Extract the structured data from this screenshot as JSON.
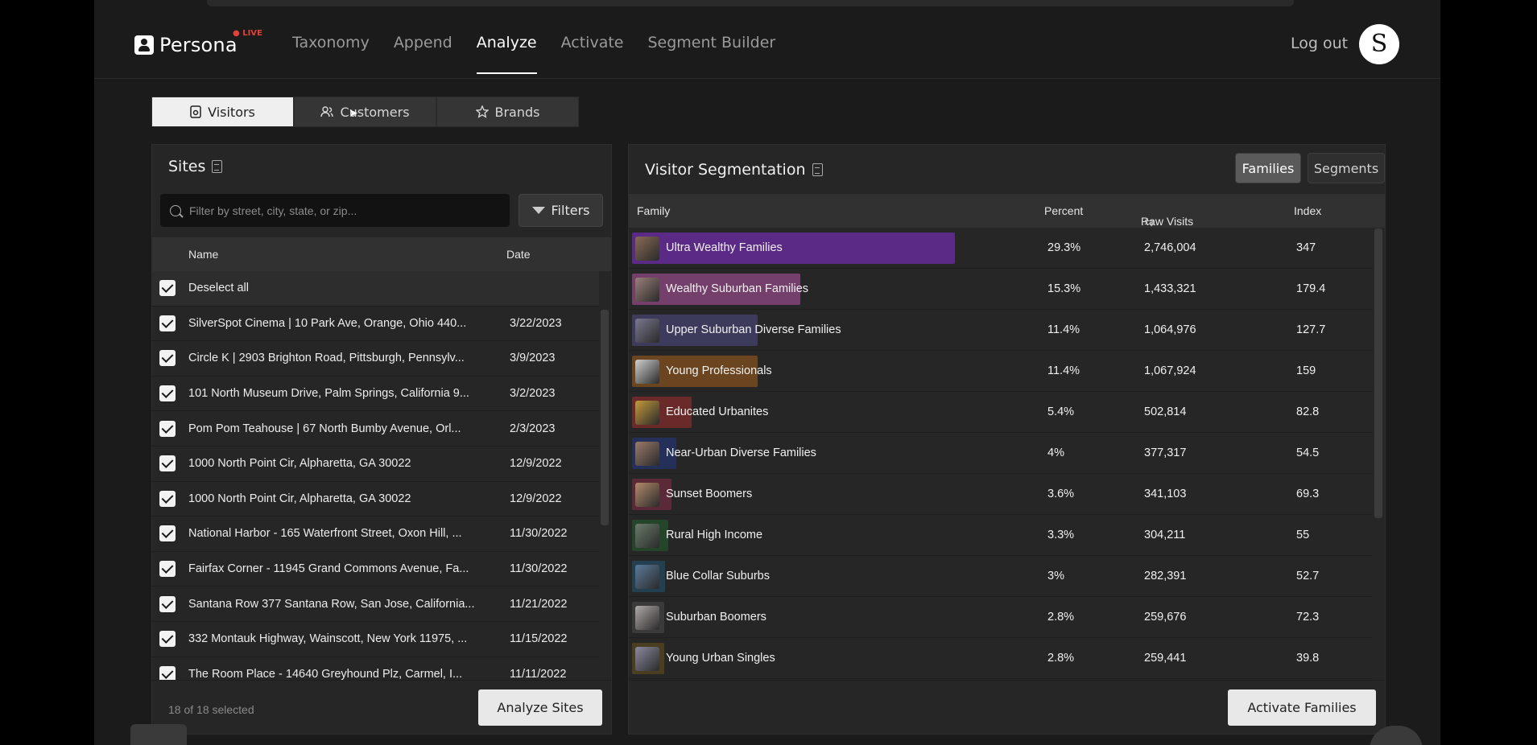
{
  "nav": {
    "brand": "Persona",
    "brand_badge": "● LIVE",
    "links": [
      "Taxonomy",
      "Append",
      "Analyze",
      "Activate",
      "Segment Builder"
    ],
    "active": "Analyze",
    "logout": "Log out",
    "avatar_letter": "S"
  },
  "tabs": [
    {
      "label": "Visitors",
      "icon": "visitors-icon",
      "active": true
    },
    {
      "label": "Customers",
      "icon": "customers-icon",
      "active": false
    },
    {
      "label": "Brands",
      "icon": "star-icon",
      "active": false
    }
  ],
  "sites": {
    "title": "Sites",
    "search_placeholder": "Filter by street, city, state, or zip...",
    "filters_label": "Filters",
    "col_name": "Name",
    "col_date": "Date",
    "deselect_all": "Deselect all",
    "rows": [
      {
        "name": "SilverSpot Cinema | 10 Park Ave, Orange, Ohio 440...",
        "date": "3/22/2023"
      },
      {
        "name": "Circle K | 2903 Brighton Road, Pittsburgh, Pennsylv...",
        "date": "3/9/2023"
      },
      {
        "name": "101 North Museum Drive, Palm Springs, California 9...",
        "date": "3/2/2023"
      },
      {
        "name": "Pom Pom Teahouse | 67 North Bumby Avenue, Orl...",
        "date": "2/3/2023"
      },
      {
        "name": "1000 North Point Cir, Alpharetta, GA 30022",
        "date": "12/9/2022"
      },
      {
        "name": "1000 North Point Cir, Alpharetta, GA 30022",
        "date": "12/9/2022"
      },
      {
        "name": "National Harbor - 165 Waterfront Street, Oxon Hill, ...",
        "date": "11/30/2022"
      },
      {
        "name": "Fairfax Corner - 11945 Grand Commons Avenue, Fa...",
        "date": "11/30/2022"
      },
      {
        "name": "Santana Row 377 Santana Row, San Jose, California...",
        "date": "11/21/2022"
      },
      {
        "name": "332 Montauk Highway, Wainscott, New York 11975, ...",
        "date": "11/15/2022"
      },
      {
        "name": "The Room Place - 14640 Greyhound Plz, Carmel, I...",
        "date": "11/11/2022"
      }
    ],
    "selected_count": "18 of 18 selected",
    "analyze_button": "Analyze Sites"
  },
  "segmentation": {
    "title": "Visitor Segmentation",
    "toggle_families": "Families",
    "toggle_segments": "Segments",
    "col_family": "Family",
    "col_percent": "Percent",
    "col_raw": "Raw Visits",
    "col_index": "Index",
    "rows": [
      {
        "name": "Ultra Wealthy Families",
        "percent": "29.3%",
        "share": 29.3,
        "raw": "2,746,004",
        "index": "347",
        "color": "#5a2a86",
        "thumb": "#8a6a55"
      },
      {
        "name": "Wealthy Suburban Families",
        "percent": "15.3%",
        "share": 15.3,
        "raw": "1,433,321",
        "index": "179.4",
        "color": "#74406b",
        "thumb": "#9a7f7a"
      },
      {
        "name": "Upper Suburban Diverse Families",
        "percent": "11.4%",
        "share": 11.4,
        "raw": "1,064,976",
        "index": "127.7",
        "color": "#3d3b5c",
        "thumb": "#7a7890"
      },
      {
        "name": "Young Professionals",
        "percent": "11.4%",
        "share": 11.4,
        "raw": "1,067,924",
        "index": "159",
        "color": "#6b4520",
        "thumb": "#cfcfcf"
      },
      {
        "name": "Educated Urbanites",
        "percent": "5.4%",
        "share": 5.4,
        "raw": "502,814",
        "index": "82.8",
        "color": "#6a2a2a",
        "thumb": "#c49a3a"
      },
      {
        "name": "Near-Urban Diverse Families",
        "percent": "4%",
        "share": 4,
        "raw": "377,317",
        "index": "54.5",
        "color": "#25305a",
        "thumb": "#9a7a6a"
      },
      {
        "name": "Sunset Boomers",
        "percent": "3.6%",
        "share": 3.6,
        "raw": "341,103",
        "index": "69.3",
        "color": "#5a2a38",
        "thumb": "#b58a6a"
      },
      {
        "name": "Rural High Income",
        "percent": "3.3%",
        "share": 3.3,
        "raw": "304,211",
        "index": "55",
        "color": "#24452a",
        "thumb": "#6a7a6a"
      },
      {
        "name": "Blue Collar Suburbs",
        "percent": "3%",
        "share": 3,
        "raw": "282,391",
        "index": "52.7",
        "color": "#244050",
        "thumb": "#5a7a9a"
      },
      {
        "name": "Suburban Boomers",
        "percent": "2.8%",
        "share": 2.8,
        "raw": "259,676",
        "index": "72.3",
        "color": "#3a3a3a",
        "thumb": "#b0a8a8"
      },
      {
        "name": "Young Urban Singles",
        "percent": "2.8%",
        "share": 2.8,
        "raw": "259,441",
        "index": "39.8",
        "color": "#4a3e20",
        "thumb": "#8a8aa0"
      }
    ],
    "activate_button": "Activate Families"
  }
}
